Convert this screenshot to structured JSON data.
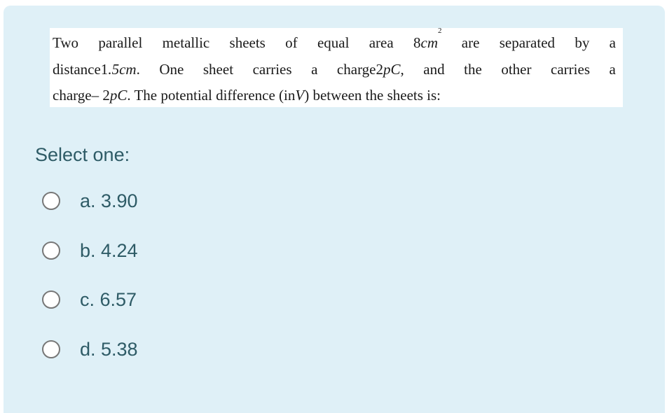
{
  "question": {
    "line1": [
      "Two",
      "parallel",
      "metallic",
      "sheets",
      "of",
      "equal",
      "area",
      "8",
      "cm",
      "2",
      "are",
      "separated",
      "by",
      "a"
    ],
    "line1_parts": {
      "words_before": [
        "Two",
        "parallel",
        "metallic",
        "sheets",
        "of",
        "equal",
        "area"
      ],
      "area_value": "8",
      "area_unit": "cm",
      "area_exp": "2",
      "words_after": [
        "are",
        "separated",
        "by",
        "a"
      ]
    },
    "line2_parts": {
      "distance_prefix": "distance1",
      "distance_unit": ".5cm",
      "dot": ".",
      "words_mid": [
        "One",
        "sheet",
        "carries",
        "a"
      ],
      "charge_prefix": "charge2",
      "charge_unit": "pC",
      "comma": ",",
      "words_after": [
        "and",
        "the",
        "other",
        "carries",
        "a"
      ]
    },
    "line3_parts": {
      "charge_prefix": "charge– 2",
      "charge_unit": "pC",
      "text_mid": ". The potential difference (in",
      "unit": "V",
      "text_end": ") between the sheets is:"
    },
    "full_text": "Two parallel metallic sheets of equal area 8cm² are separated by a distance 1.5cm. One sheet carries a charge 2pC, and the other carries a charge −2pC. The potential difference (in V) between the sheets is:"
  },
  "prompt": "Select one:",
  "options": [
    {
      "letter": "a.",
      "value": "3.90",
      "label": "a. 3.90",
      "selected": false
    },
    {
      "letter": "b.",
      "value": "4.24",
      "label": "b. 4.24",
      "selected": false
    },
    {
      "letter": "c.",
      "value": "6.57",
      "label": "c. 6.57",
      "selected": false
    },
    {
      "letter": "d.",
      "value": "5.38",
      "label": "d. 5.38",
      "selected": false
    }
  ],
  "colors": {
    "panel_bg": "#dff0f7",
    "text_teal": "#2e5b66",
    "radio_border": "#777777"
  }
}
